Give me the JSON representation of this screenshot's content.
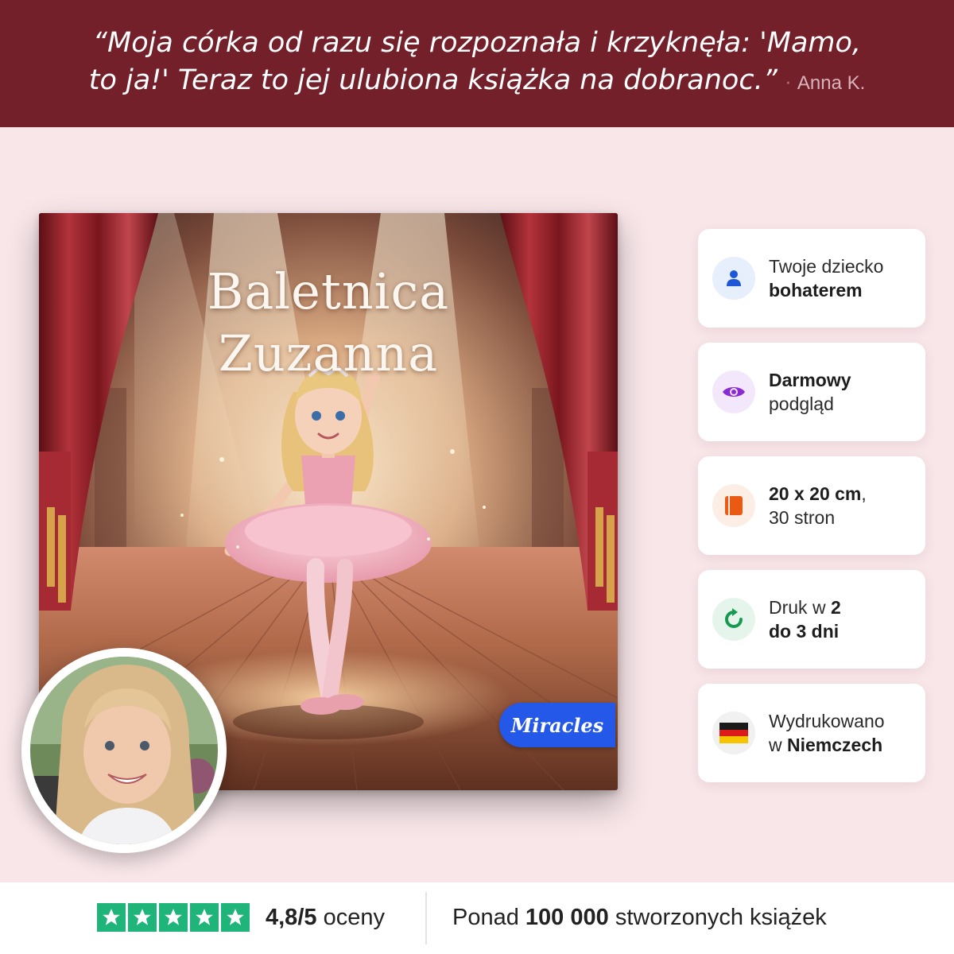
{
  "banner": {
    "quote_line1": "“Moja córka od razu się rozpoznała i krzyknęła: 'Mamo,",
    "quote_line2": "to ja!' Teraz to jej ulubiona książka na dobranoc.”",
    "separator": "·",
    "author": "Anna K."
  },
  "book": {
    "title_line1": "Baletnica",
    "title_line2": "Zuzanna",
    "brand": "Miracles"
  },
  "features": [
    {
      "icon": "person-icon",
      "color": "#1f56d8",
      "bg": "#e7eefc",
      "pre": "Twoje dziecko",
      "bold": "bohaterem",
      "post": ""
    },
    {
      "icon": "eye-icon",
      "color": "#8a2bd1",
      "bg": "#f3e8fb",
      "bold_first": "Darmowy",
      "post": "podgląd"
    },
    {
      "icon": "book-icon",
      "color": "#ea5a12",
      "bg": "#fdeee5",
      "bold_first": "20 x 20 cm",
      "suffix": ",",
      "post": "30 stron"
    },
    {
      "icon": "refresh-icon",
      "color": "#17994f",
      "bg": "#e6f5ec",
      "pre": "Druk w ",
      "bold_a": "2",
      "bold_b": "do 3 dni"
    },
    {
      "icon": "germany-flag-icon",
      "bg": "#f1f1f1",
      "pre": "Wydrukowano",
      "pre2": "w ",
      "bold": "Niemczech"
    }
  ],
  "bottom": {
    "star_count": 5,
    "star_color": "#1fb57a",
    "rating_value": "4,8/5",
    "rating_label": "oceny",
    "created_pre": "Ponad",
    "created_count": "100 000",
    "created_post": "stworzonych książek"
  }
}
